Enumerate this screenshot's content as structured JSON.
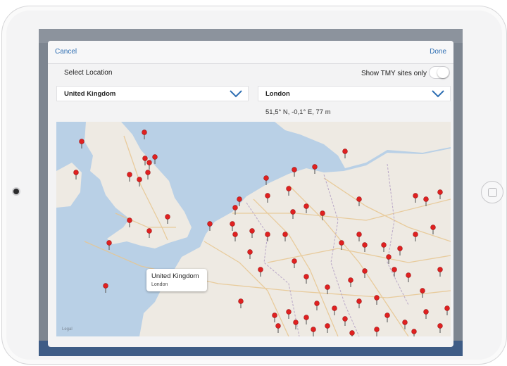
{
  "nav": {
    "cancel_label": "Cancel",
    "done_label": "Done"
  },
  "select_location_label": "Select Location",
  "tmy_toggle": {
    "label": "Show TMY sites only",
    "on": false
  },
  "country_select": {
    "value": "United Kingdom"
  },
  "city_select": {
    "value": "London"
  },
  "coordinates": "51,5° N, -0,1° E, 77 m",
  "map": {
    "callout": {
      "title": "United Kingdom",
      "subtitle": "London"
    },
    "legal_label": "Legal",
    "pin_color": "#e02020",
    "water_color": "#b9d0e6",
    "land_color": "#eeeae3"
  }
}
